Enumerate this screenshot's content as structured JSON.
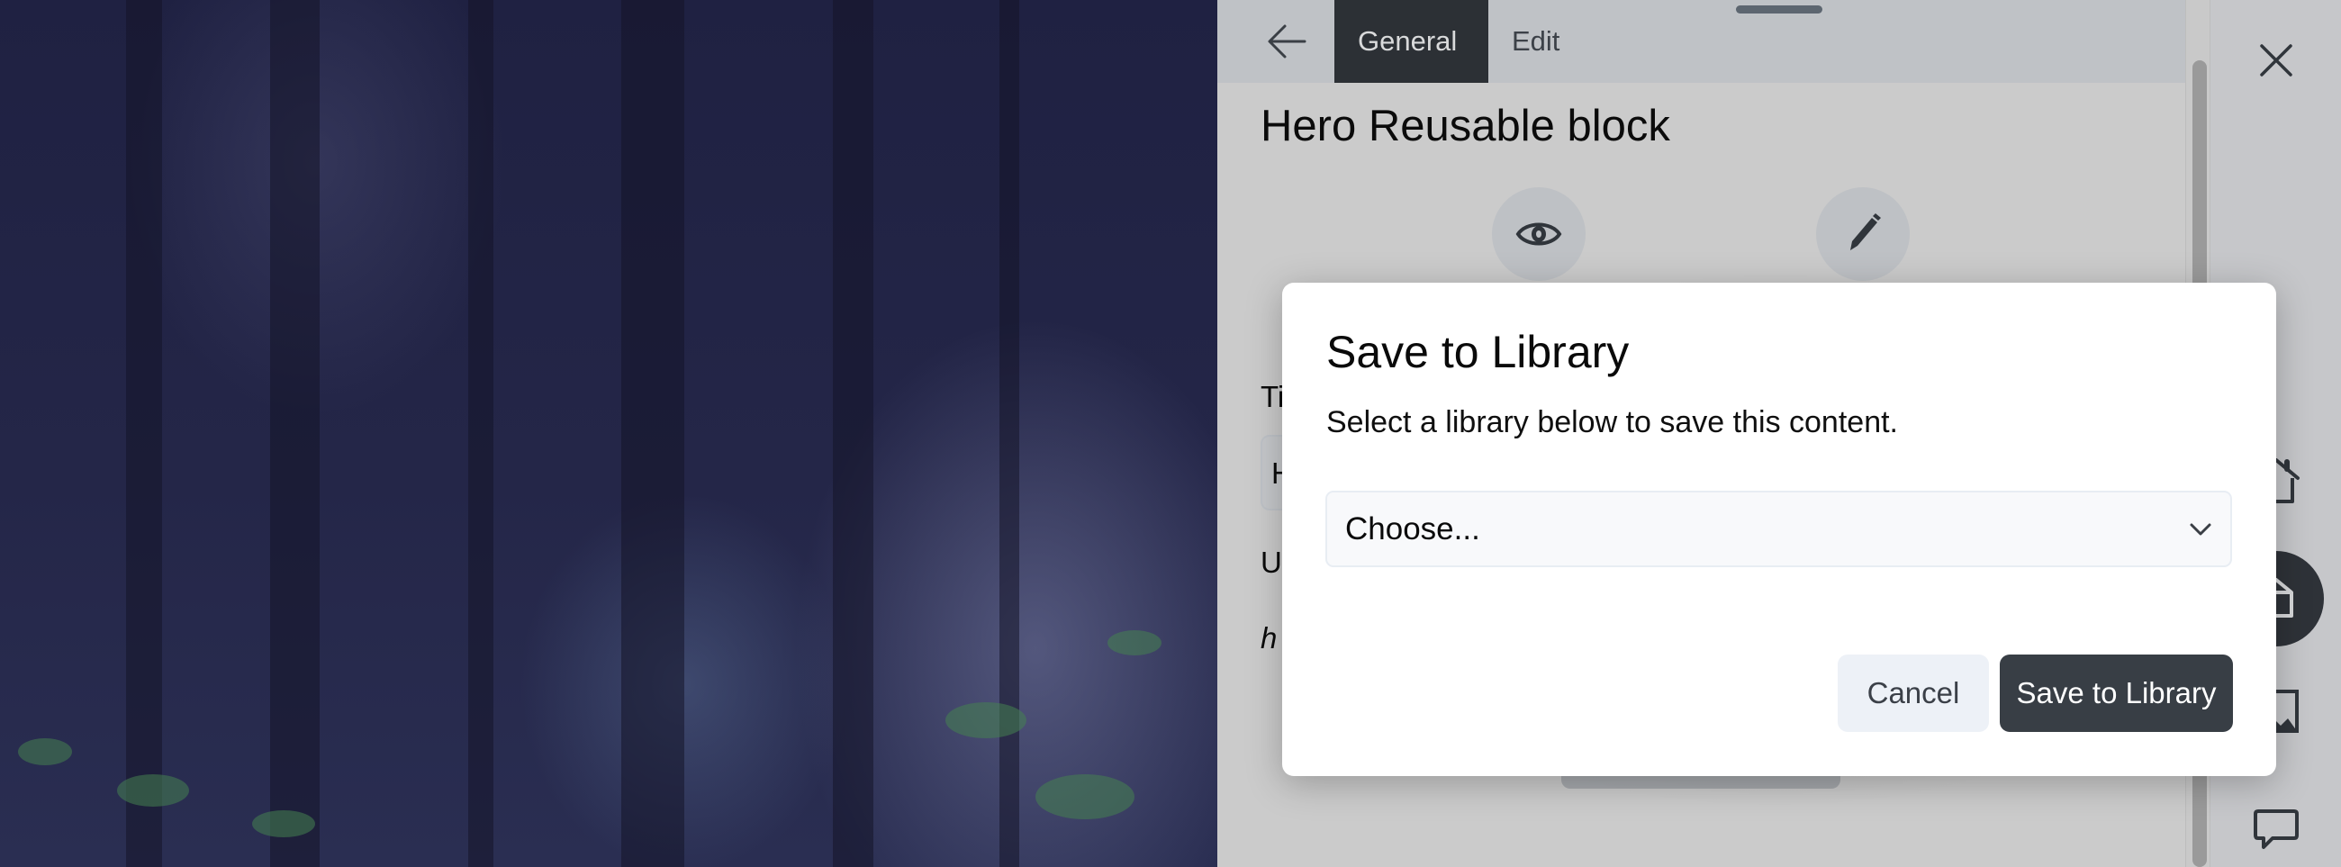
{
  "panel": {
    "tabs": [
      {
        "label": "General",
        "active": true
      },
      {
        "label": "Edit",
        "active": false
      }
    ],
    "block_title": "Hero Reusable block",
    "background_fields": {
      "title_label_visible": "Ti",
      "title_input_visible": "H",
      "url_label_visible": "U",
      "url_link_visible": "h"
    }
  },
  "rail": {
    "icons": [
      "close-icon",
      "home-icon",
      "block-icon",
      "image-icon",
      "comment-icon"
    ],
    "active_icon": "block-icon"
  },
  "dialog": {
    "title": "Save to Library",
    "description": "Select a library below to save this content.",
    "select": {
      "value": "Choose..."
    },
    "cancel_label": "Cancel",
    "save_label": "Save to Library"
  },
  "colors": {
    "primary_button": "#383e45",
    "secondary_button": "#edf1f7",
    "active_tab": "#2c3035"
  }
}
